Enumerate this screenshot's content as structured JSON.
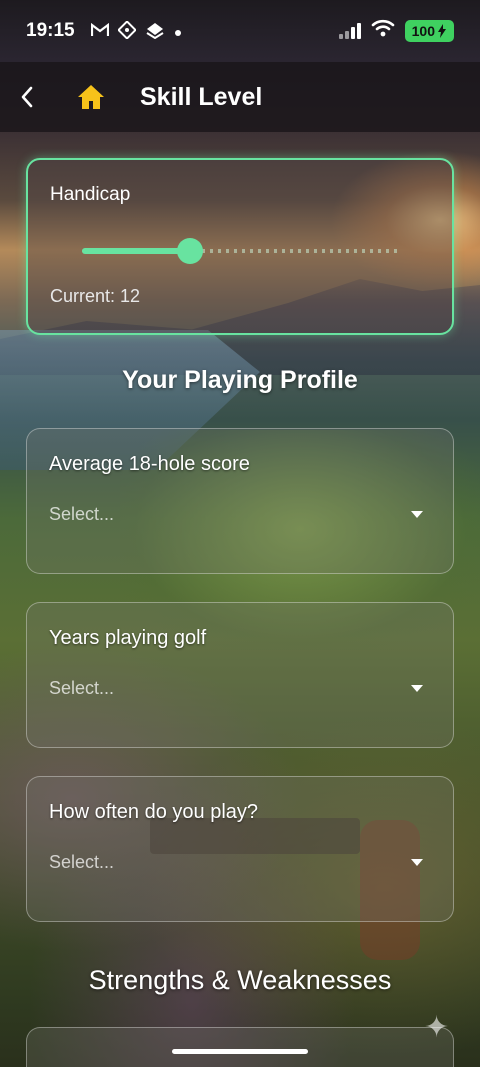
{
  "status_bar": {
    "time": "19:15",
    "notification_icons": [
      "gmail-icon",
      "proton-icon",
      "stack-icon",
      "dot-icon"
    ],
    "battery": "100"
  },
  "app_bar": {
    "title": "Skill Level"
  },
  "handicap": {
    "label": "Handicap",
    "current_text": "Current: 12",
    "slider_fraction": 0.34,
    "accent_color": "#68e3a0"
  },
  "profile": {
    "title": "Your Playing Profile",
    "fields": [
      {
        "label": "Average 18-hole score",
        "placeholder": "Select..."
      },
      {
        "label": "Years playing golf",
        "placeholder": "Select..."
      },
      {
        "label": "How often do you play?",
        "placeholder": "Select..."
      }
    ]
  },
  "strengths": {
    "title": "Strengths & Weaknesses"
  }
}
